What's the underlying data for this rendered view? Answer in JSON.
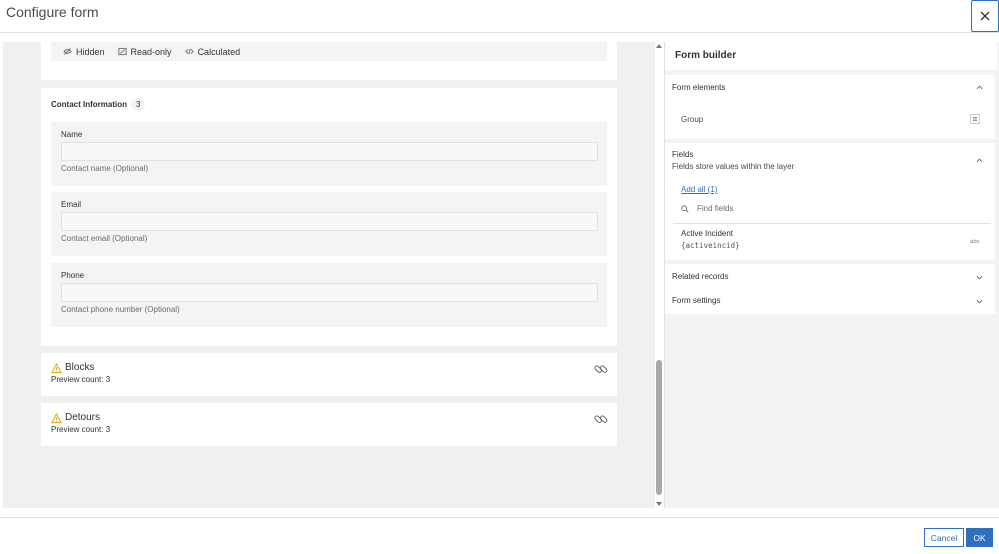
{
  "dialog": {
    "title": "Configure form"
  },
  "canvas": {
    "properties": [
      {
        "icon": "hidden-icon",
        "label": "Hidden"
      },
      {
        "icon": "read-only-icon",
        "label": "Read-only"
      },
      {
        "icon": "calculated-icon",
        "label": "Calculated"
      }
    ],
    "group": {
      "title": "Contact Information",
      "count": "3",
      "fields": [
        {
          "label": "Name",
          "hint": "Contact name (Optional)"
        },
        {
          "label": "Email",
          "hint": "Contact email (Optional)"
        },
        {
          "label": "Phone",
          "hint": "Contact phone number (Optional)"
        }
      ]
    },
    "related": [
      {
        "title": "Blocks",
        "preview": "Preview count: 3"
      },
      {
        "title": "Detours",
        "preview": "Preview count: 3"
      }
    ]
  },
  "panel": {
    "title": "Form builder",
    "form_elements": {
      "title": "Form elements",
      "items": [
        {
          "label": "Group",
          "icon": "group-icon"
        }
      ]
    },
    "fields": {
      "title": "Fields",
      "subtitle": "Fields store values within the layer",
      "add_all": "Add all (1)",
      "search_placeholder": "Find fields",
      "items": [
        {
          "label": "Active Incident",
          "name": "{activeincid}",
          "type_icon": "text-type-icon"
        }
      ]
    },
    "related_records": {
      "title": "Related records"
    },
    "form_settings": {
      "title": "Form settings"
    }
  },
  "footer": {
    "cancel_label": "Cancel",
    "ok_label": "OK"
  },
  "colors": {
    "accent": "#2e6fc0",
    "warning": "#d9a300",
    "canvas_bg": "#f0f0f0"
  }
}
